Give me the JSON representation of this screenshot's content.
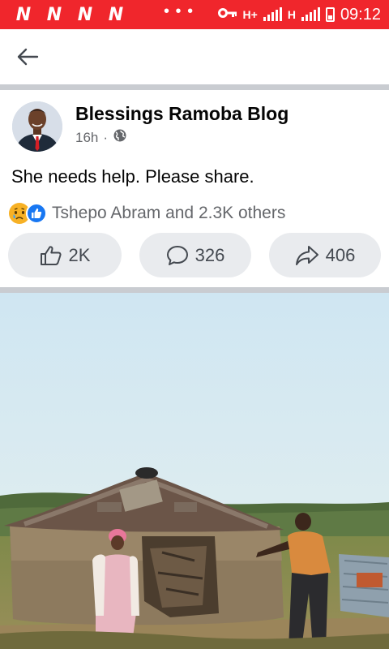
{
  "status_bar": {
    "notification_icons": [
      "N",
      "N",
      "N",
      "N"
    ],
    "more_indicator": "• • •",
    "key_icon": "key-icon",
    "network_1": "H+",
    "network_2": "H",
    "time": "09:12",
    "color": "#f0262c"
  },
  "nav": {
    "back_icon": "arrow-left-icon"
  },
  "post": {
    "author": "Blessings Ramoba Blog",
    "time_ago": "16h",
    "separator": "·",
    "audience_icon": "globe-icon",
    "text": "She needs help. Please share.",
    "reactions_summary": "Tshepo Abram and 2.3K others",
    "reaction_icons": [
      "sad-icon",
      "like-icon"
    ],
    "actions": {
      "like_count": "2K",
      "comment_count": "326",
      "share_count": "406"
    }
  },
  "photo": {
    "description_icon": "post-photo"
  },
  "colors": {
    "accent": "#1877f2",
    "button_bg": "#e9ebee",
    "secondary_text": "#65676b",
    "divider": "#c9ccd1"
  }
}
